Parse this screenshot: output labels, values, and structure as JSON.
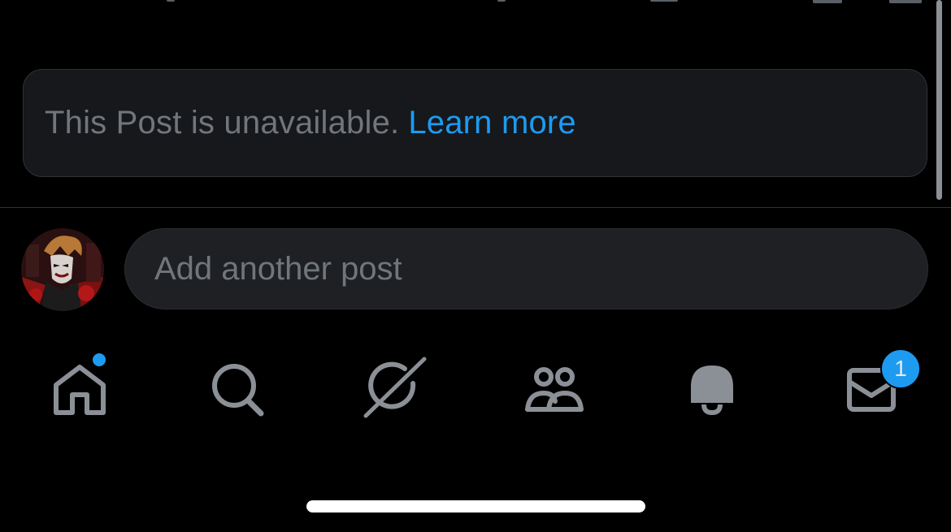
{
  "notice": {
    "message": "This Post is unavailable.",
    "link_label": "Learn more"
  },
  "composer": {
    "placeholder": "Add another post",
    "avatar": "user-avatar"
  },
  "tabs": [
    {
      "name": "home",
      "icon": "home-icon",
      "has_dot": true
    },
    {
      "name": "search",
      "icon": "search-icon"
    },
    {
      "name": "grok",
      "icon": "grok-icon"
    },
    {
      "name": "communities",
      "icon": "communities-icon"
    },
    {
      "name": "notifications",
      "icon": "bell-icon"
    },
    {
      "name": "messages",
      "icon": "mail-icon",
      "badge": "1"
    }
  ],
  "colors": {
    "background": "#000000",
    "surface": "#16181c",
    "border": "#2f3336",
    "muted_text": "#71767b",
    "accent": "#1d9bf0",
    "icon": "#8b9096"
  }
}
